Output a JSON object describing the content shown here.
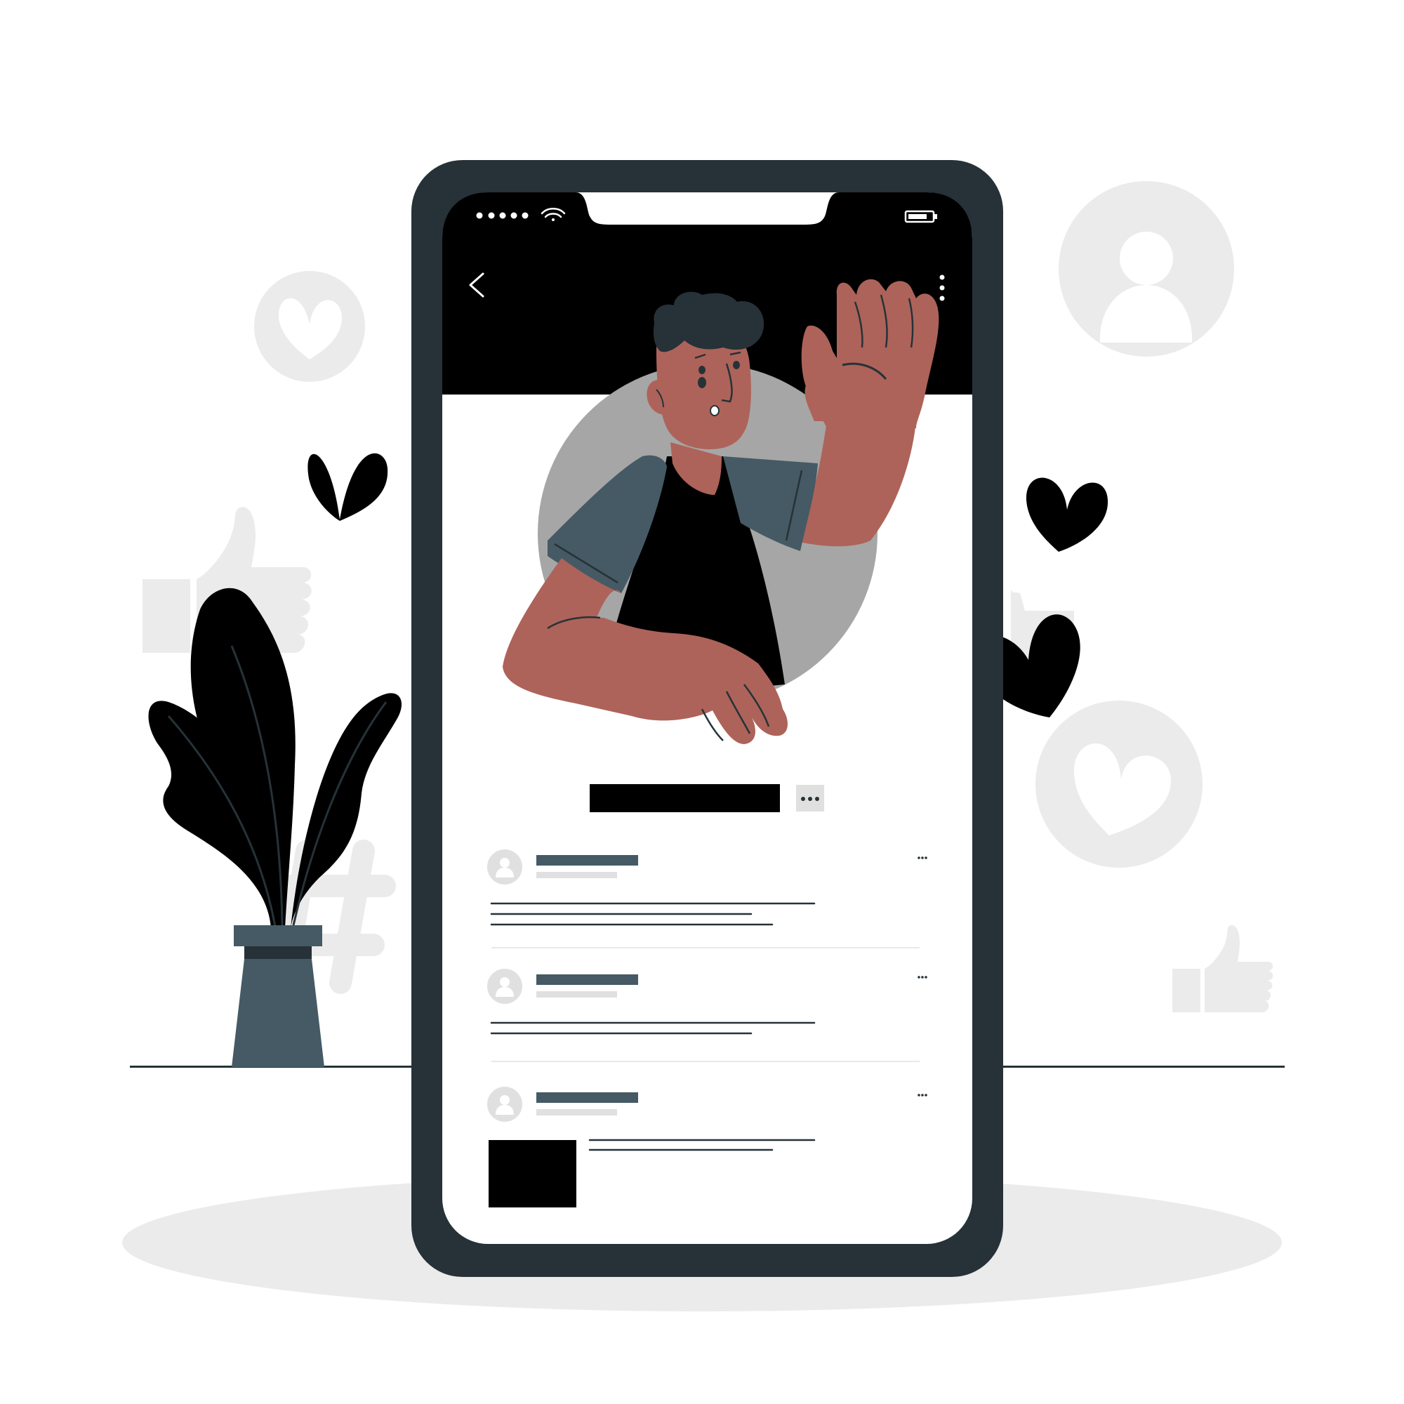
{
  "colors": {
    "phone_frame": "#263238",
    "screen_bg": "#ffffff",
    "screen_header": "#000000",
    "skin": "#ad6359",
    "shirt": "#000000",
    "sleeve": "#455a64",
    "avatar_gray": "#a6a6a6",
    "decor_gray": "#ebebeb",
    "placeholder_dark": "#455a64",
    "placeholder_light": "#e0e0e0",
    "heart": "#000000",
    "plant_leaf": "#000000",
    "pot": "#455a64"
  },
  "status_bar": {
    "signal_dots": 5,
    "wifi_icon": "wifi-icon",
    "battery_icon": "battery-icon"
  },
  "app_header": {
    "back_icon": "chevron-left-icon",
    "more_icon": "vertical-dots-icon"
  },
  "profile": {
    "name_placeholder": "redacted-name-bar",
    "more_button_icon": "horizontal-dots-icon"
  },
  "posts": [
    {
      "avatar_icon": "user-icon",
      "more_icon": "horizontal-dots-icon",
      "text_lines": 3,
      "has_image": false
    },
    {
      "avatar_icon": "user-icon",
      "more_icon": "horizontal-dots-icon",
      "text_lines": 2,
      "has_image": false
    },
    {
      "avatar_icon": "user-icon",
      "more_icon": "horizontal-dots-icon",
      "text_lines": 2,
      "has_image": true
    }
  ],
  "decorations": [
    "heart-badge-icon",
    "user-badge-icon",
    "thumbs-up-icon",
    "hashtag-icon",
    "heart-icon",
    "plant",
    "pot"
  ]
}
